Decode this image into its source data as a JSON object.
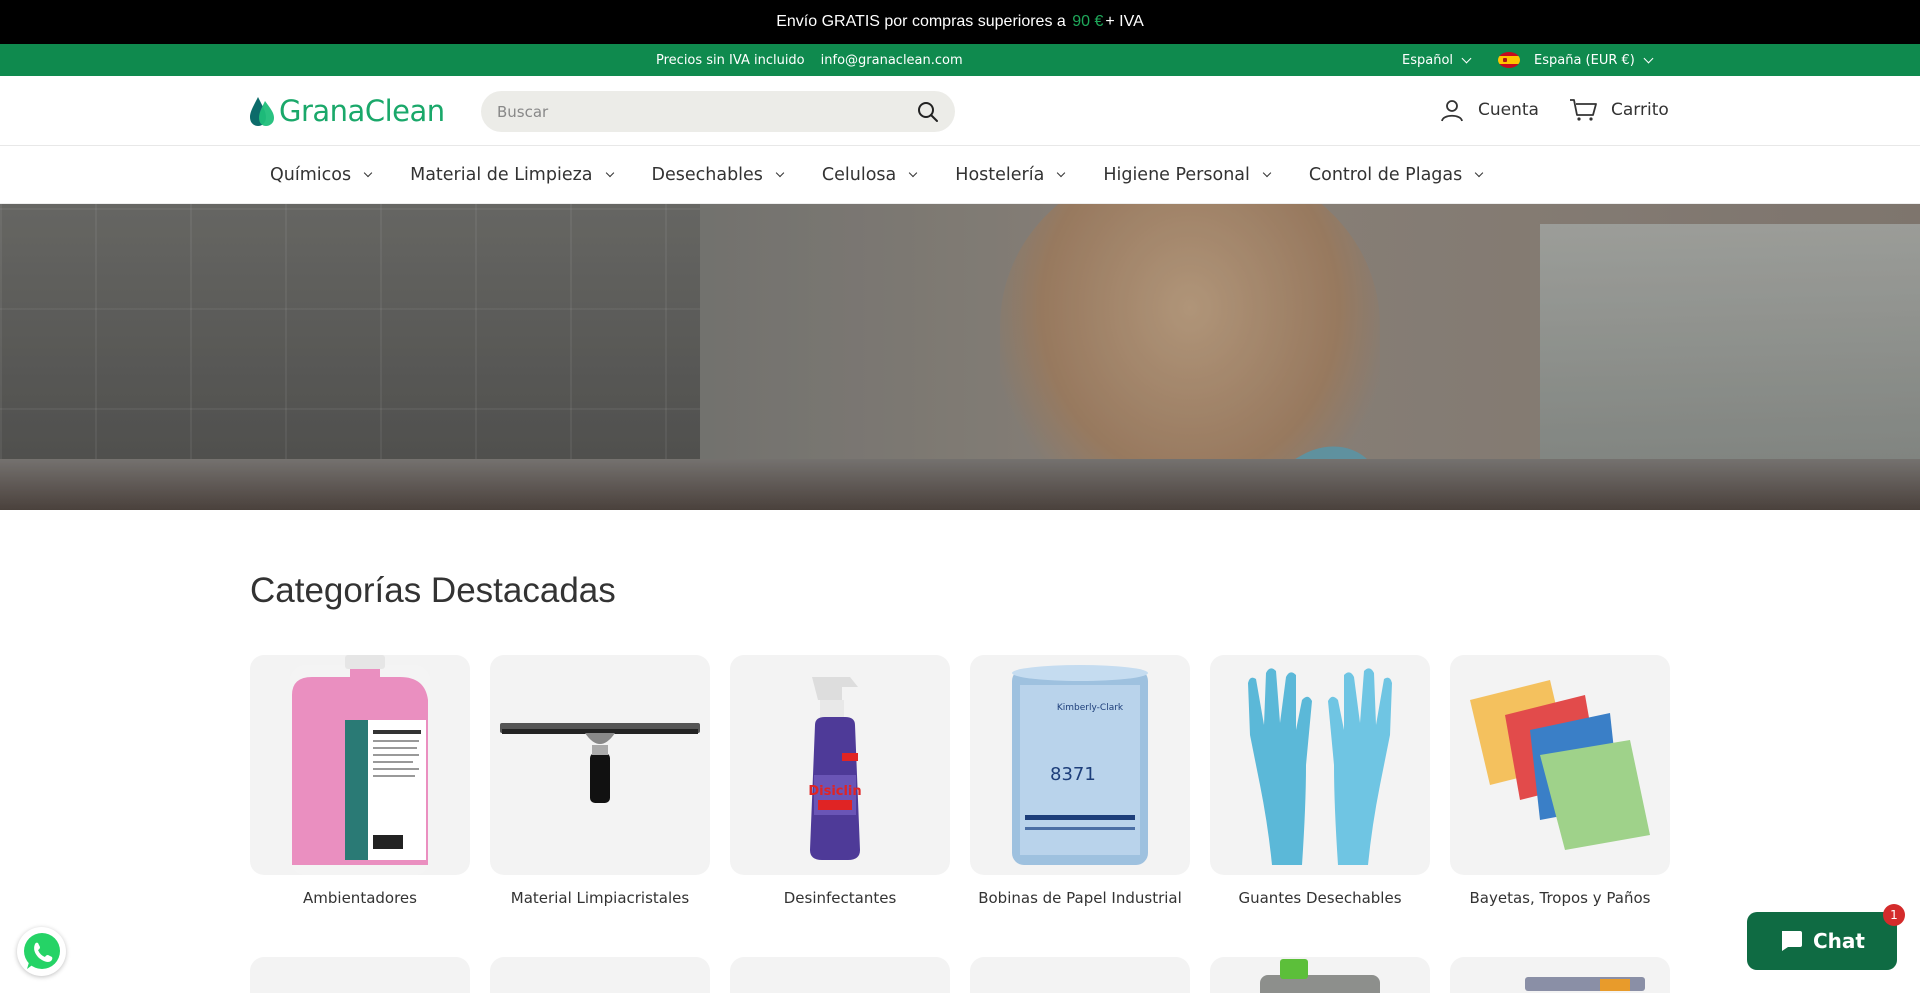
{
  "announcement": {
    "text_before": "Envío GRATIS por compras superiores a",
    "price": "90 €",
    "text_after": "+ IVA"
  },
  "utility": {
    "tax_note": "Precios sin IVA incluido",
    "email": "info@granaclean.com",
    "language": "Español",
    "country": "España (EUR €)"
  },
  "header": {
    "logo_text": "GranaClean",
    "search_placeholder": "Buscar",
    "account_label": "Cuenta",
    "cart_label": "Carrito"
  },
  "nav": {
    "items": [
      {
        "label": "Químicos"
      },
      {
        "label": "Material de Limpieza"
      },
      {
        "label": "Desechables"
      },
      {
        "label": "Celulosa"
      },
      {
        "label": "Hostelería"
      },
      {
        "label": "Higiene Personal"
      },
      {
        "label": "Control de Plagas"
      }
    ]
  },
  "featured": {
    "title": "Categorías Destacadas",
    "categories": [
      {
        "label": "Ambientadores"
      },
      {
        "label": "Material Limpiacristales"
      },
      {
        "label": "Desinfectantes"
      },
      {
        "label": "Bobinas de Papel Industrial"
      },
      {
        "label": "Guantes Desechables"
      },
      {
        "label": "Bayetas, Tropos y Paños"
      }
    ]
  },
  "chat": {
    "label": "Chat",
    "badge": "1"
  },
  "colors": {
    "brand_green": "#0f8a4e",
    "logo_green": "#1aa86a",
    "chat_green": "#0f6b43"
  }
}
